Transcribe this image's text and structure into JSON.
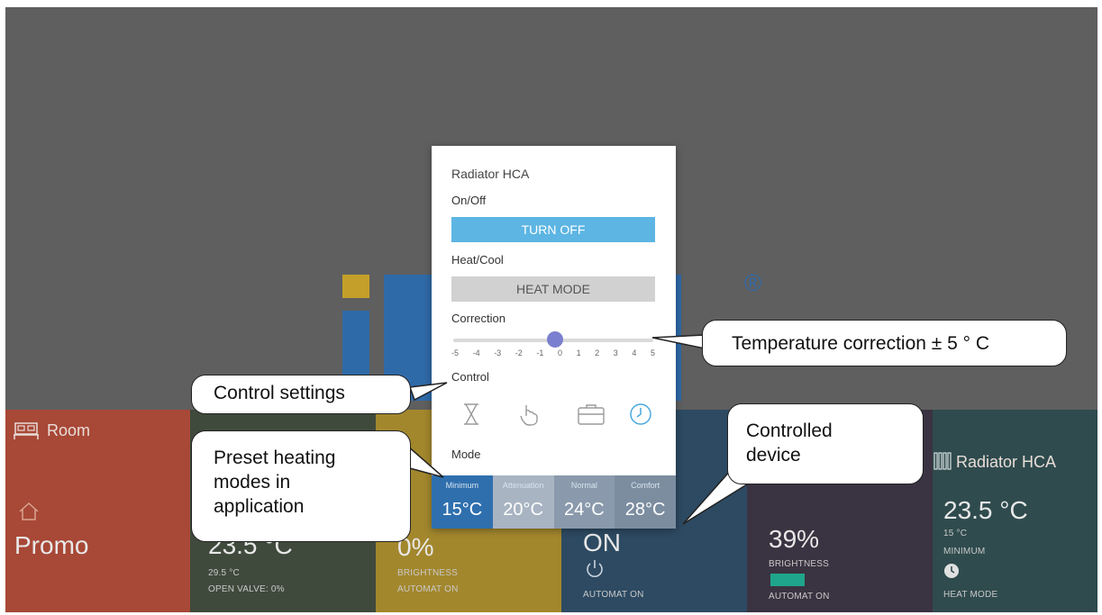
{
  "logo": {
    "registered_mark": "®"
  },
  "tiles": [
    {
      "title": "Room",
      "value": "Promo",
      "color": "#a84837"
    },
    {
      "value": "23.5 °C",
      "sub1": "29.5 °C",
      "sub2": "OPEN VALVE: 0%",
      "color": "#3f4a3c"
    },
    {
      "value": "0%",
      "sub1": "BRIGHTNESS",
      "sub2": "AUTOMAT ON",
      "color": "#a3872d"
    },
    {
      "value": "ON",
      "sub1": "AUTOMAT ON",
      "color": "#2d4a62"
    },
    {
      "value": "39%",
      "sub1": "BRIGHTNESS",
      "sub2": "AUTOMAT ON",
      "color": "#3a3341"
    },
    {
      "title": "Radiator HCA",
      "value": "23.5 °C",
      "sub1": "15 °C",
      "sub2": "MINIMUM",
      "sub3": "HEAT MODE",
      "color": "#2f4b4e"
    }
  ],
  "dialog": {
    "title": "Radiator HCA",
    "onoff_label": "On/Off",
    "turn_off_button": "TURN OFF",
    "heatcool_label": "Heat/Cool",
    "heat_mode_button": "HEAT MODE",
    "correction_label": "Correction",
    "correction_ticks": [
      "-5",
      "-4",
      "-3",
      "-2",
      "-1",
      "0",
      "1",
      "2",
      "3",
      "4",
      "5"
    ],
    "correction_value": 0,
    "control_label": "Control",
    "control_icons": [
      "hourglass-icon",
      "hand-icon",
      "briefcase-icon",
      "clock-icon"
    ],
    "control_selected": "clock-icon",
    "mode_label": "Mode",
    "modes": [
      {
        "name": "Minimum",
        "temp": "15°C",
        "selected": true
      },
      {
        "name": "Attenuation",
        "temp": "20°C"
      },
      {
        "name": "Normal",
        "temp": "24°C"
      },
      {
        "name": "Comfort",
        "temp": "28°C"
      }
    ]
  },
  "callouts": {
    "control_settings": "Control settings",
    "preset_modes": [
      "Preset heating",
      "modes in",
      "application"
    ],
    "temp_correction": "Temperature correction ± 5 ° C",
    "controlled_device": [
      "Controlled",
      "device"
    ]
  },
  "colors": {
    "accent": "#5db5e3",
    "thumb": "#7b7fd0",
    "mode_selected": "#2f6fae"
  }
}
